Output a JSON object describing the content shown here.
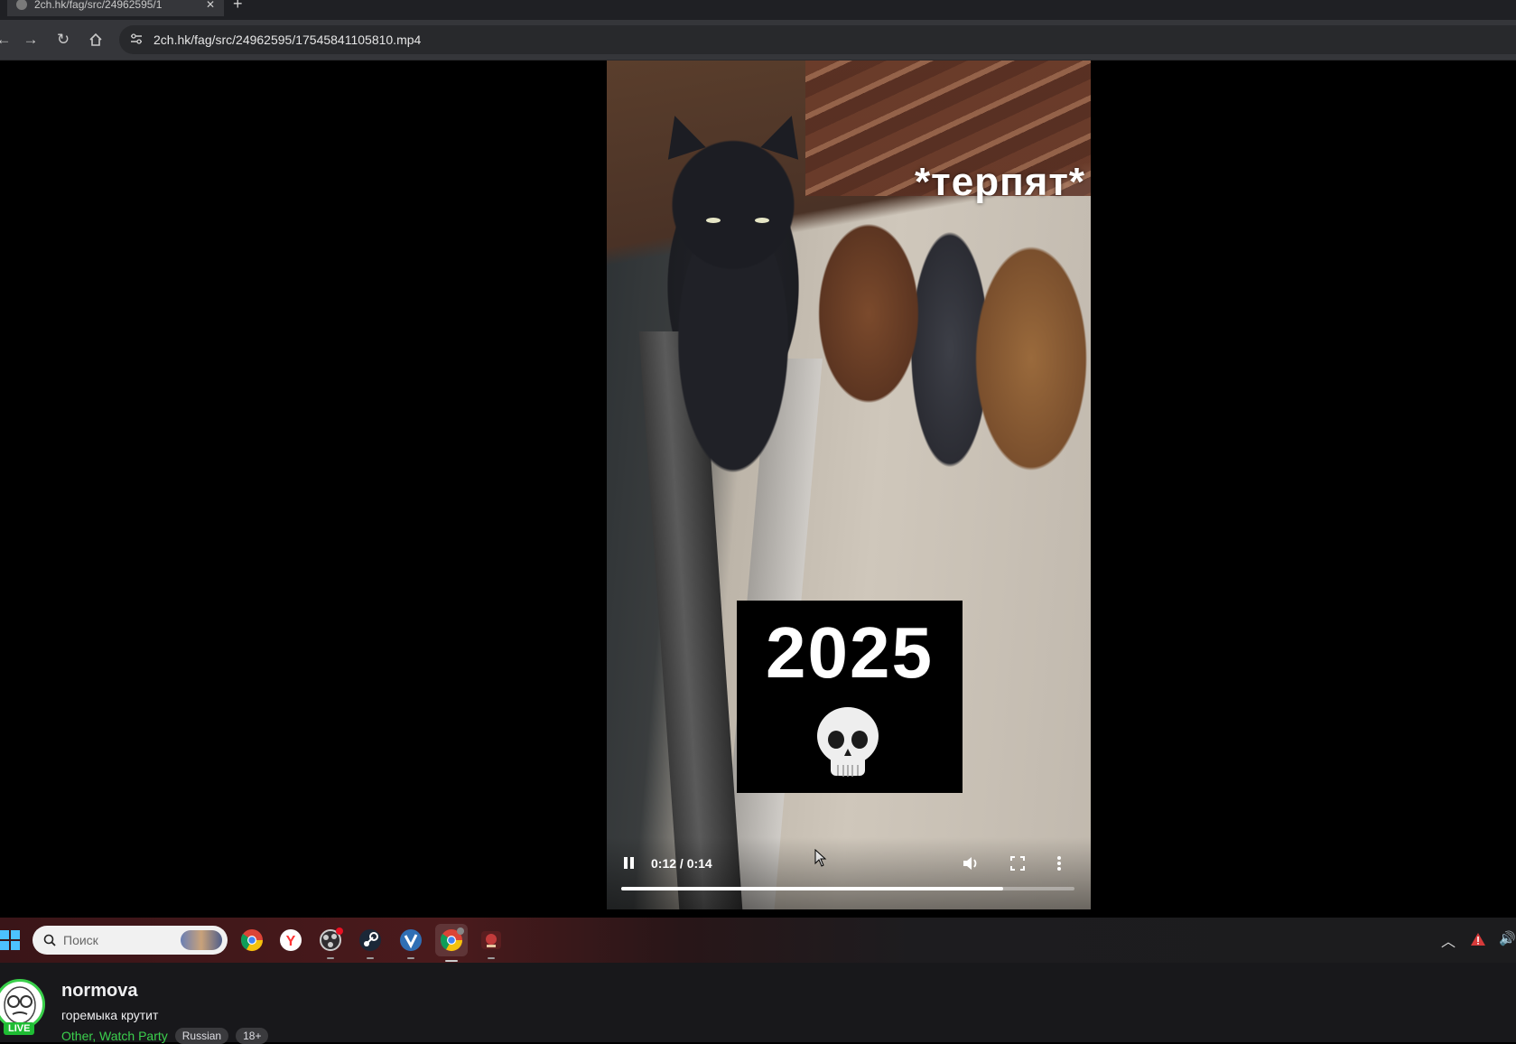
{
  "browser": {
    "tab_title": "2ch.hk/fag/src/24962595/1",
    "tab_close": "✕",
    "new_tab": "+",
    "url": "2ch.hk/fag/src/24962595/17545841105810.mp4"
  },
  "video": {
    "overlay_caption": "*терпят*",
    "year_caption": "2025",
    "current_time": "0:12",
    "duration": "0:14",
    "time_label": "0:12 / 0:14",
    "progress_fraction": 0.843
  },
  "taskbar": {
    "search_placeholder": "Поиск",
    "apps": [
      "chrome-icon",
      "yandex-browser-icon",
      "obs-icon",
      "steam-icon",
      "vpn-icon",
      "chrome-icon",
      "game-icon"
    ]
  },
  "stream": {
    "channel_name": "normova",
    "title": "горемыка крутит",
    "categories": "Other, Watch Party",
    "tags": [
      "Russian",
      "18+"
    ],
    "live_label": "LIVE",
    "accent_color": "#3bd04d"
  }
}
